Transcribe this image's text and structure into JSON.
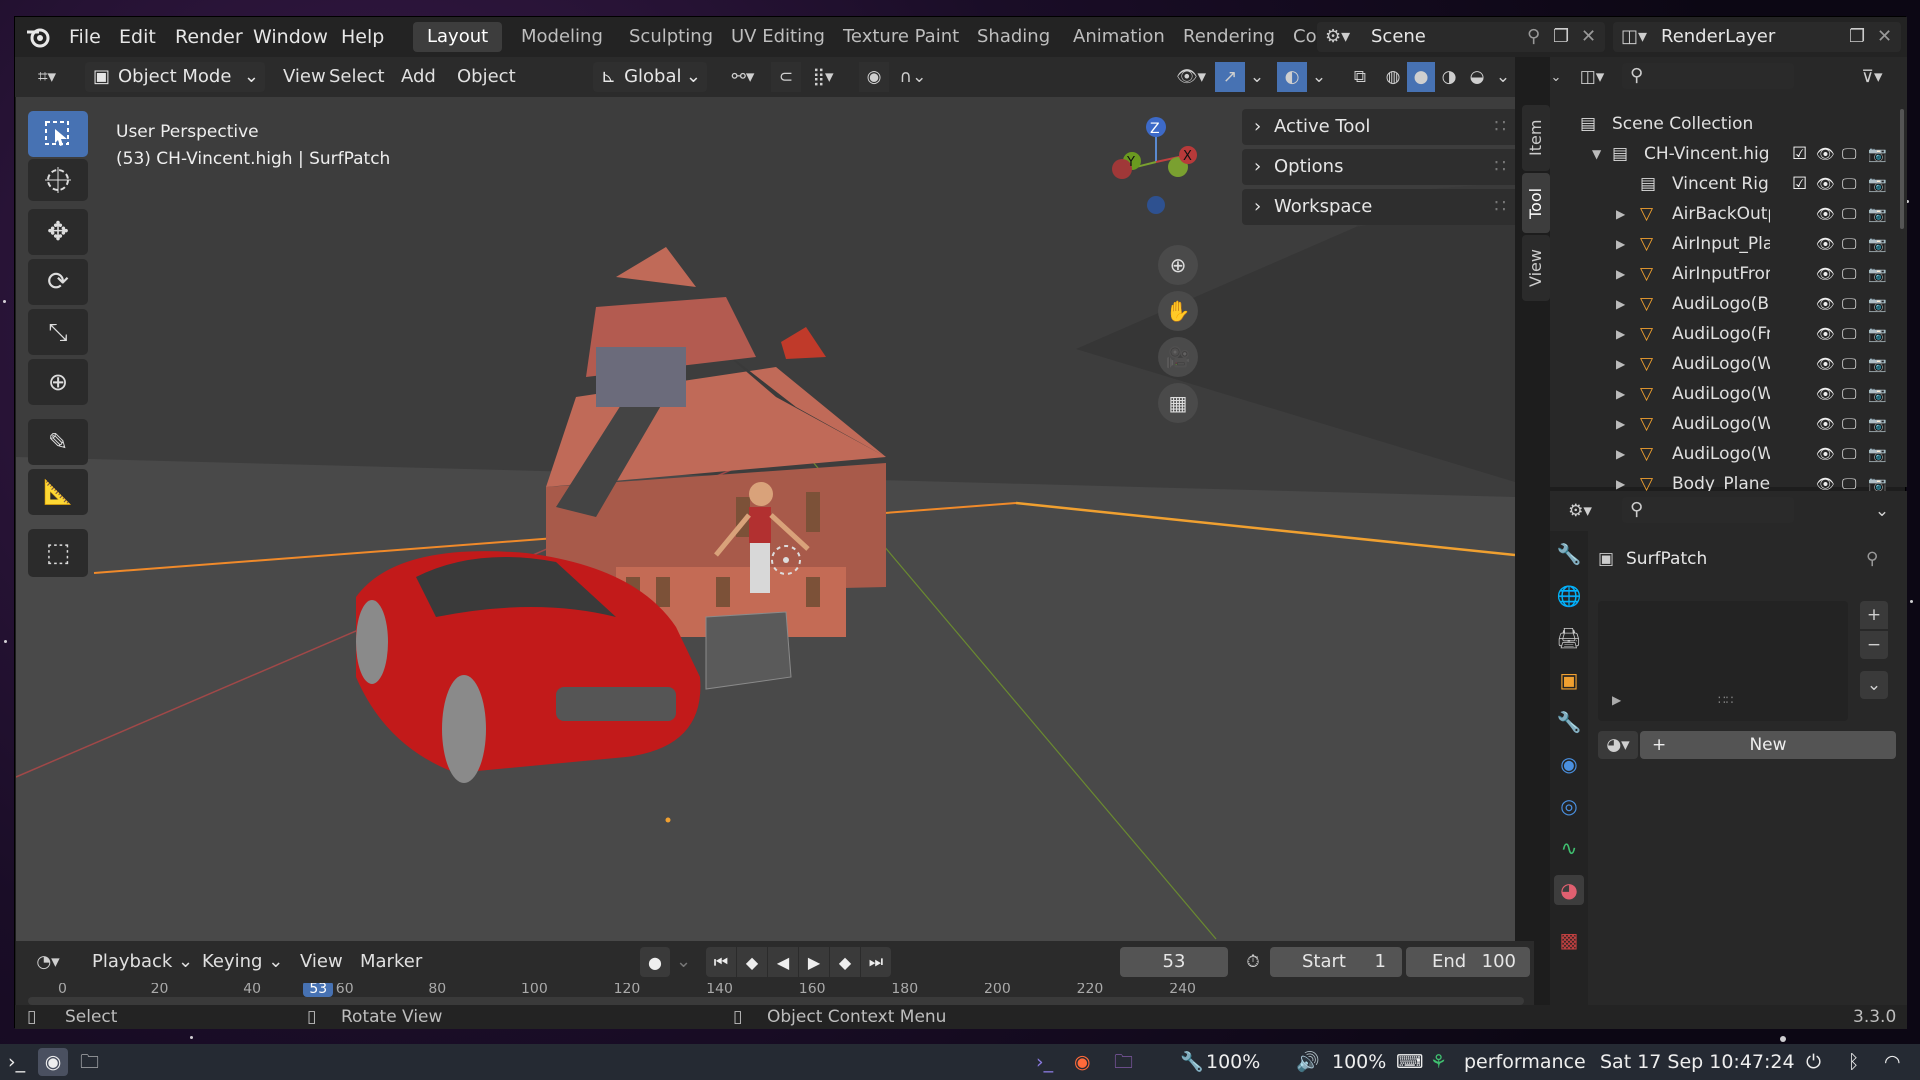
{
  "window": {
    "menus": [
      "File",
      "Edit",
      "Render",
      "Window",
      "Help"
    ],
    "workspaces": [
      {
        "label": "Layout",
        "active": true
      },
      {
        "label": "Modeling"
      },
      {
        "label": "Sculpting"
      },
      {
        "label": "UV Editing"
      },
      {
        "label": "Texture Paint"
      },
      {
        "label": "Shading"
      },
      {
        "label": "Animation"
      },
      {
        "label": "Rendering"
      },
      {
        "label": "Co"
      }
    ],
    "scene": "Scene",
    "view_layer": "RenderLayer"
  },
  "viewport_header": {
    "mode": "Object Mode",
    "menus": [
      "View",
      "Select",
      "Add",
      "Object"
    ],
    "orientation": "Global"
  },
  "viewport": {
    "perspective": "User Perspective",
    "context": "(53) CH-Vincent.high | SurfPatch",
    "gizmo": {
      "x": "X",
      "y": "Y",
      "z": "Z"
    },
    "tools": [
      "select-box-icon",
      "cursor-icon",
      "move-icon",
      "rotate-icon",
      "scale-icon",
      "transform-icon",
      "annotate-icon",
      "measure-icon",
      "add-cube-icon"
    ],
    "npanels": [
      "Active Tool",
      "Options",
      "Workspace"
    ],
    "sidetabs": [
      "Item",
      "Tool",
      "View"
    ]
  },
  "outliner": {
    "root": "Scene Collection",
    "rows": [
      {
        "name": "CH-Vincent.high",
        "type": "collection",
        "indent": 1,
        "checked": true
      },
      {
        "name": "Vincent Rig",
        "type": "collection",
        "indent": 2,
        "checked": true
      },
      {
        "name": "AirBackOutp",
        "type": "mesh",
        "indent": 2
      },
      {
        "name": "AirInput_Plar",
        "type": "mesh",
        "indent": 2
      },
      {
        "name": "AirInputFront",
        "type": "mesh",
        "indent": 2
      },
      {
        "name": "AudiLogo(Ba",
        "type": "mesh",
        "indent": 2
      },
      {
        "name": "AudiLogo(Fr",
        "type": "mesh",
        "indent": 2
      },
      {
        "name": "AudiLogo(Wl",
        "type": "mesh",
        "indent": 2
      },
      {
        "name": "AudiLogo(Wl",
        "type": "mesh",
        "indent": 2
      },
      {
        "name": "AudiLogo(Wl",
        "type": "mesh",
        "indent": 2
      },
      {
        "name": "AudiLogo(Wl",
        "type": "mesh",
        "indent": 2
      },
      {
        "name": "Body_Plane",
        "type": "mesh",
        "indent": 2
      }
    ]
  },
  "properties": {
    "object_name": "SurfPatch",
    "new_button": "New"
  },
  "timeline": {
    "menus": [
      "Playback",
      "Keying",
      "View",
      "Marker"
    ],
    "current_frame": "53",
    "start_label": "Start",
    "start": "1",
    "end_label": "End",
    "end": "100",
    "ruler": [
      "0",
      "20",
      "40",
      "53",
      "60",
      "80",
      "100",
      "120",
      "140",
      "160",
      "180",
      "200",
      "220",
      "240"
    ]
  },
  "statusbar": {
    "select": "Select",
    "rotate": "Rotate View",
    "context_menu": "Object Context Menu",
    "version": "3.3.0"
  },
  "taskbar": {
    "brightness": "100%",
    "volume": "100%",
    "power_profile": "performance",
    "datetime": "Sat 17 Sep 10:47:24"
  }
}
